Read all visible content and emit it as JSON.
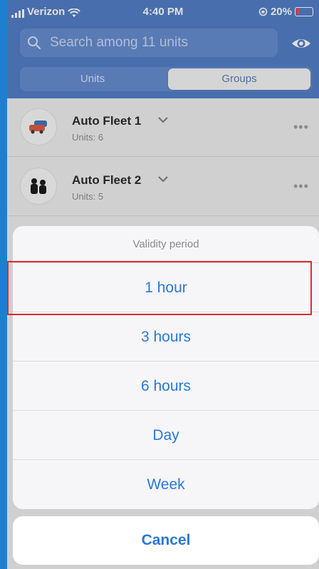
{
  "status_bar": {
    "carrier": "Verizon",
    "time": "4:40 PM",
    "battery": "20%"
  },
  "search": {
    "placeholder": "Search among 11 units"
  },
  "tabs": {
    "units": "Units",
    "groups": "Groups",
    "active": "Groups"
  },
  "groups": [
    {
      "name": "Auto Fleet 1",
      "units": "Units: 6",
      "icon": "cars-icon"
    },
    {
      "name": "Auto Fleet 2",
      "units": "Units: 5",
      "icon": "people-icon"
    }
  ],
  "action_sheet": {
    "title": "Validity period",
    "options": [
      "1 hour",
      "3 hours",
      "6 hours",
      "Day",
      "Week"
    ],
    "highlighted": "1 hour",
    "cancel": "Cancel"
  },
  "colors": {
    "header": "#4a78c4",
    "accent": "#2a78d6",
    "highlight_border": "#e02a2a"
  }
}
